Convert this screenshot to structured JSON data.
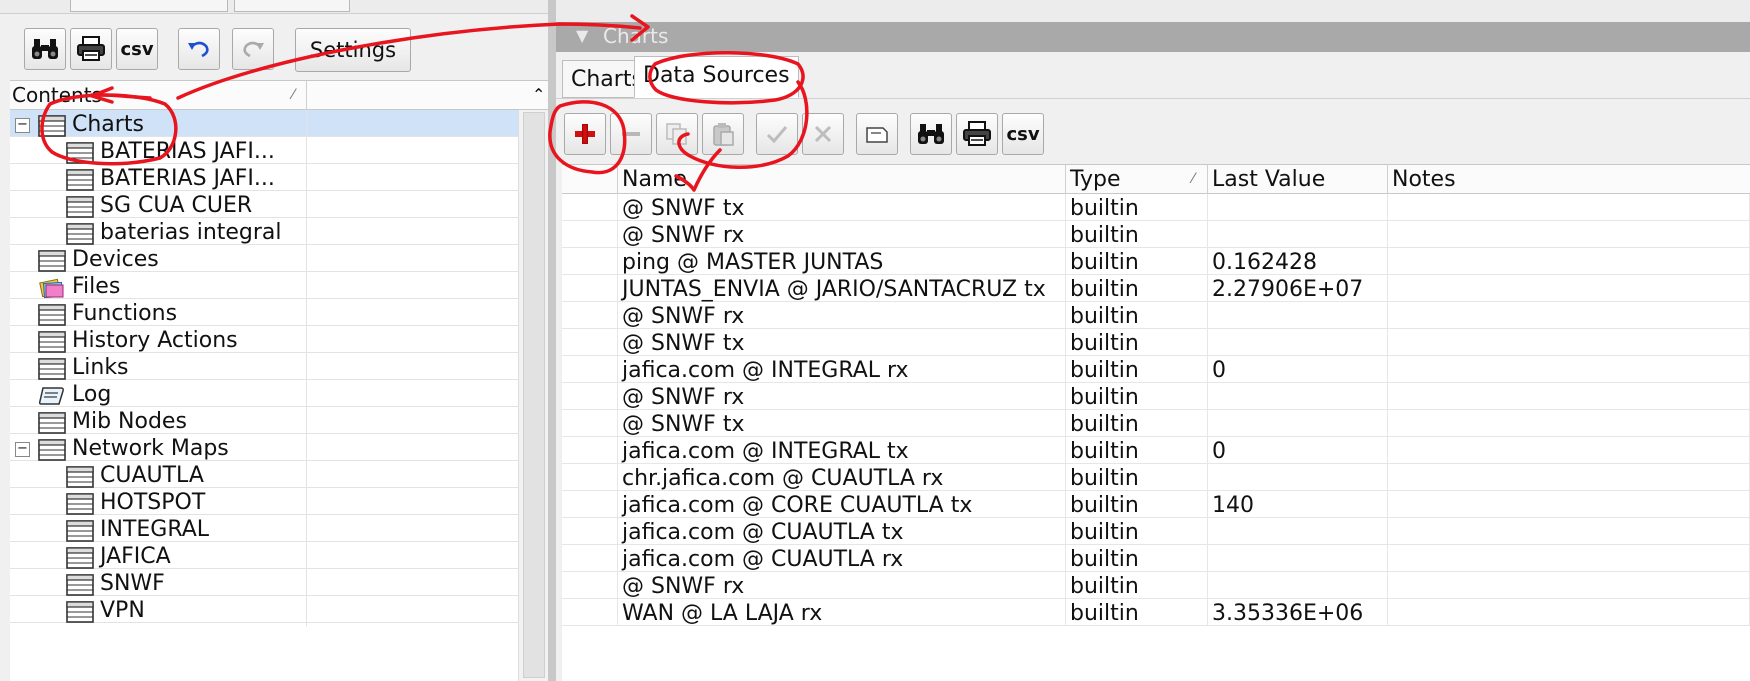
{
  "left_toolbar": {
    "csv_label": "csv",
    "settings_label": "Settings"
  },
  "tree": {
    "header": "Contents",
    "items": [
      {
        "label": "Charts",
        "indent": 0,
        "icon": "table",
        "expander": "−",
        "selected": true
      },
      {
        "label": "BATERIAS JAFI...",
        "indent": 1,
        "icon": "table",
        "expander": "",
        "selected": false
      },
      {
        "label": "BATERIAS JAFI...",
        "indent": 1,
        "icon": "table",
        "expander": "",
        "selected": false
      },
      {
        "label": "SG CUA CUER",
        "indent": 1,
        "icon": "table",
        "expander": "",
        "selected": false
      },
      {
        "label": "baterias integral",
        "indent": 1,
        "icon": "table",
        "expander": "",
        "selected": false
      },
      {
        "label": "Devices",
        "indent": 0,
        "icon": "table",
        "expander": "",
        "selected": false
      },
      {
        "label": "Files",
        "indent": 0,
        "icon": "files",
        "expander": "",
        "selected": false
      },
      {
        "label": "Functions",
        "indent": 0,
        "icon": "table",
        "expander": "",
        "selected": false
      },
      {
        "label": "History Actions",
        "indent": 0,
        "icon": "table",
        "expander": "",
        "selected": false
      },
      {
        "label": "Links",
        "indent": 0,
        "icon": "table",
        "expander": "",
        "selected": false
      },
      {
        "label": "Log",
        "indent": 0,
        "icon": "log",
        "expander": "",
        "selected": false
      },
      {
        "label": "Mib Nodes",
        "indent": 0,
        "icon": "table",
        "expander": "",
        "selected": false
      },
      {
        "label": "Network Maps",
        "indent": 0,
        "icon": "table",
        "expander": "−",
        "selected": false
      },
      {
        "label": "CUAUTLA",
        "indent": 1,
        "icon": "table",
        "expander": "",
        "selected": false
      },
      {
        "label": "HOTSPOT",
        "indent": 1,
        "icon": "table",
        "expander": "",
        "selected": false
      },
      {
        "label": "INTEGRAL",
        "indent": 1,
        "icon": "table",
        "expander": "",
        "selected": false
      },
      {
        "label": "JAFICA",
        "indent": 1,
        "icon": "table",
        "expander": "",
        "selected": false
      },
      {
        "label": "SNWF",
        "indent": 1,
        "icon": "table",
        "expander": "",
        "selected": false
      },
      {
        "label": "VPN",
        "indent": 1,
        "icon": "table",
        "expander": "",
        "selected": false
      }
    ]
  },
  "right_panel": {
    "title": "Charts",
    "tabs": [
      {
        "label": "Charts",
        "active": false
      },
      {
        "label": "Data Sources",
        "active": true
      }
    ],
    "toolbar_csv_label": "csv"
  },
  "grid": {
    "columns": [
      "Name",
      "Type",
      "Last Value",
      "Notes"
    ],
    "rows": [
      {
        "name": "@ SNWF tx",
        "type": "builtin",
        "last_value": "",
        "notes": ""
      },
      {
        "name": "@ SNWF rx",
        "type": "builtin",
        "last_value": "",
        "notes": ""
      },
      {
        "name": "ping @ MASTER JUNTAS",
        "type": "builtin",
        "last_value": "0.162428",
        "notes": ""
      },
      {
        "name": "JUNTAS_ENVIA @ JARIO/SANTACRUZ tx",
        "type": "builtin",
        "last_value": "2.27906E+07",
        "notes": ""
      },
      {
        "name": "@ SNWF rx",
        "type": "builtin",
        "last_value": "",
        "notes": ""
      },
      {
        "name": "@ SNWF tx",
        "type": "builtin",
        "last_value": "",
        "notes": ""
      },
      {
        "name": "jafica.com @ INTEGRAL rx",
        "type": "builtin",
        "last_value": "0",
        "notes": ""
      },
      {
        "name": "@ SNWF rx",
        "type": "builtin",
        "last_value": "",
        "notes": ""
      },
      {
        "name": "@ SNWF tx",
        "type": "builtin",
        "last_value": "",
        "notes": ""
      },
      {
        "name": "jafica.com @ INTEGRAL tx",
        "type": "builtin",
        "last_value": "0",
        "notes": ""
      },
      {
        "name": "chr.jafica.com @ CUAUTLA rx",
        "type": "builtin",
        "last_value": "",
        "notes": ""
      },
      {
        "name": "jafica.com @ CORE CUAUTLA tx",
        "type": "builtin",
        "last_value": "140",
        "notes": ""
      },
      {
        "name": "jafica.com @ CUAUTLA tx",
        "type": "builtin",
        "last_value": "",
        "notes": ""
      },
      {
        "name": "jafica.com @ CUAUTLA rx",
        "type": "builtin",
        "last_value": "",
        "notes": ""
      },
      {
        "name": "@ SNWF rx",
        "type": "builtin",
        "last_value": "",
        "notes": ""
      },
      {
        "name": "WAN @ LA LAJA rx",
        "type": "builtin",
        "last_value": "3.35336E+06",
        "notes": ""
      }
    ]
  },
  "colors": {
    "selection": "#cfe2f7",
    "annotation": "#e8141e",
    "add_icon": "#d01010"
  }
}
